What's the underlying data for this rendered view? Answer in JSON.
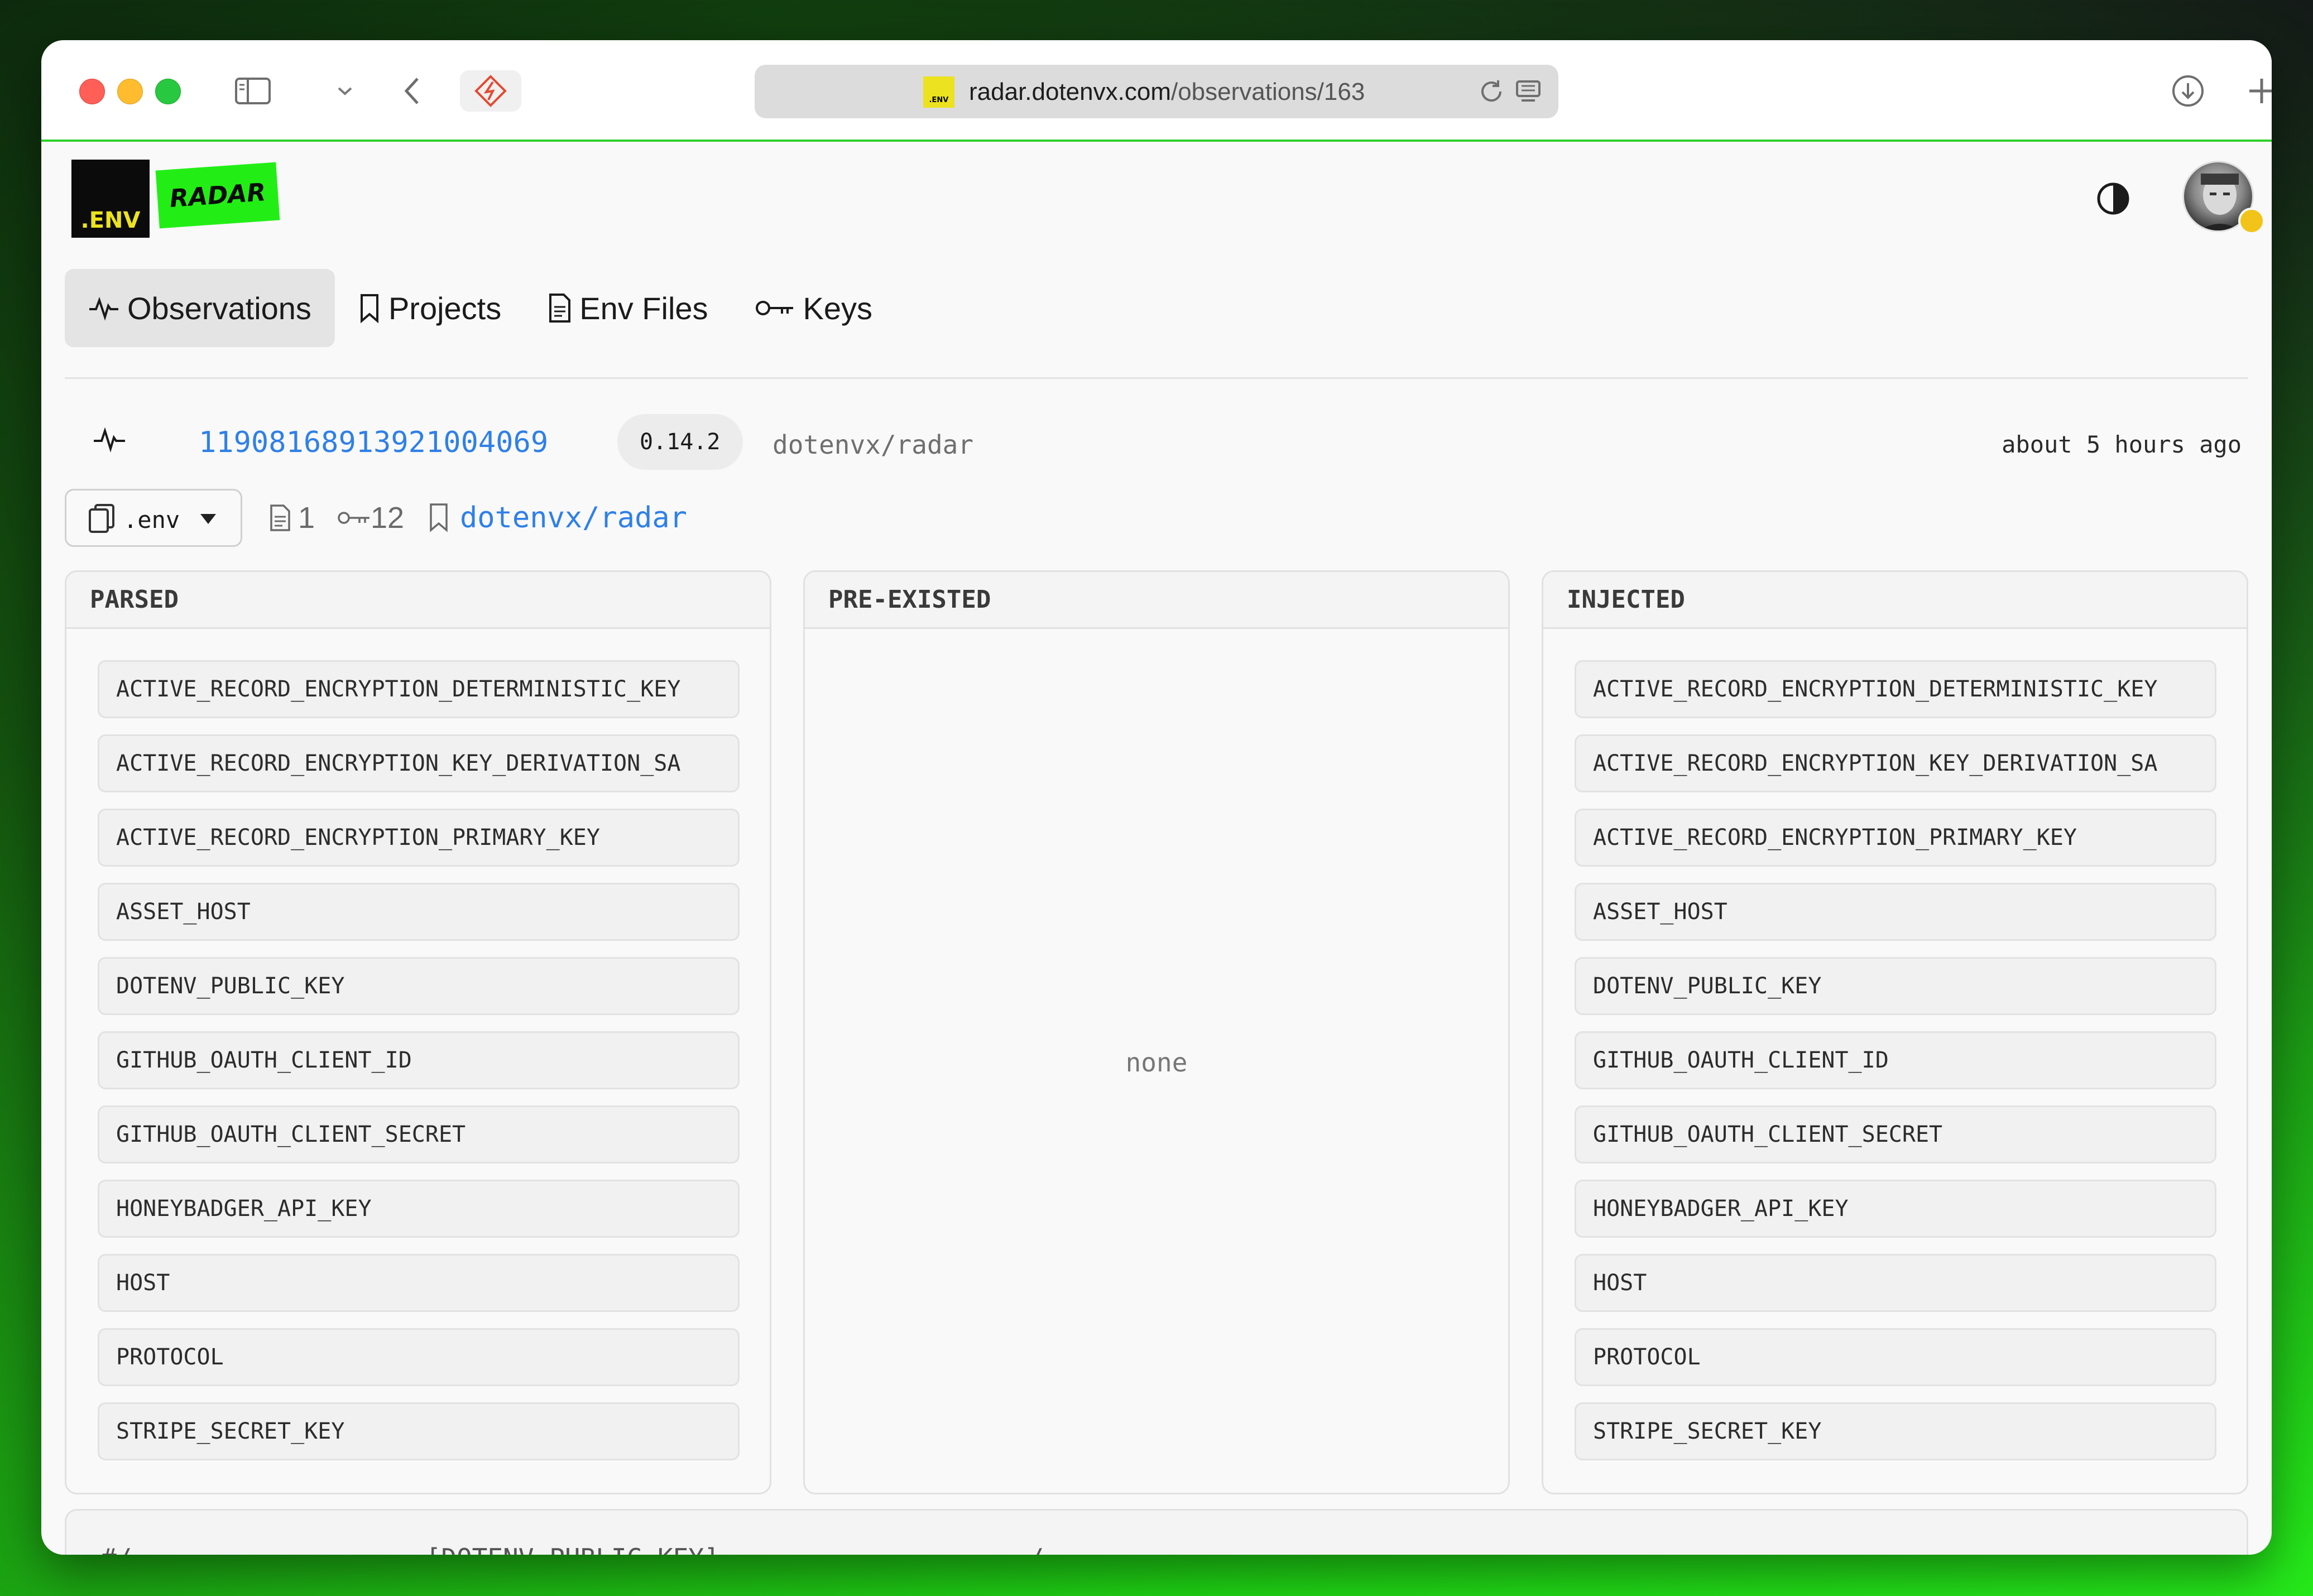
{
  "browser": {
    "url_host": "radar.dotenvx.com",
    "url_path": "/observations/163",
    "favicon_text": ".ENV"
  },
  "brand": {
    "env_label": ".ENV",
    "radar_label": "RADAR",
    "accent_color": "#22ee16",
    "env_color": "#ece21f"
  },
  "nav": {
    "items": [
      {
        "label": "Observations",
        "icon": "activity-icon",
        "active": true
      },
      {
        "label": "Projects",
        "icon": "bookmark-icon",
        "active": false
      },
      {
        "label": "Env Files",
        "icon": "file-icon",
        "active": false
      },
      {
        "label": "Keys",
        "icon": "key-icon",
        "active": false
      }
    ]
  },
  "observation": {
    "id": "11908168913921004069",
    "version": "0.14.2",
    "project": "dotenvx/radar",
    "time": "about 5 hours ago",
    "link_color": "#2f80e8"
  },
  "file_row": {
    "selected_file": ".env",
    "file_count": "1",
    "key_count": "12",
    "project_link": "dotenvx/radar"
  },
  "panels": {
    "parsed": {
      "title": "PARSED",
      "keys": [
        "ACTIVE_RECORD_ENCRYPTION_DETERMINISTIC_KEY",
        "ACTIVE_RECORD_ENCRYPTION_KEY_DERIVATION_SA",
        "ACTIVE_RECORD_ENCRYPTION_PRIMARY_KEY",
        "ASSET_HOST",
        "DOTENV_PUBLIC_KEY",
        "GITHUB_OAUTH_CLIENT_ID",
        "GITHUB_OAUTH_CLIENT_SECRET",
        "HONEYBADGER_API_KEY",
        "HOST",
        "PROTOCOL",
        "STRIPE_SECRET_KEY"
      ]
    },
    "pre_existed": {
      "title": "PRE-EXISTED",
      "empty_text": "none"
    },
    "injected": {
      "title": "INJECTED",
      "keys": [
        "ACTIVE_RECORD_ENCRYPTION_DETERMINISTIC_KEY",
        "ACTIVE_RECORD_ENCRYPTION_KEY_DERIVATION_SA",
        "ACTIVE_RECORD_ENCRYPTION_PRIMARY_KEY",
        "ASSET_HOST",
        "DOTENV_PUBLIC_KEY",
        "GITHUB_OAUTH_CLIENT_ID",
        "GITHUB_OAUTH_CLIENT_SECRET",
        "HONEYBADGER_API_KEY",
        "HOST",
        "PROTOCOL",
        "STRIPE_SECRET_KEY"
      ]
    }
  },
  "bottom_card": {
    "code_preview": "#/-------------------[DOTENV_PUBLIC_KEY]--------------------/"
  }
}
